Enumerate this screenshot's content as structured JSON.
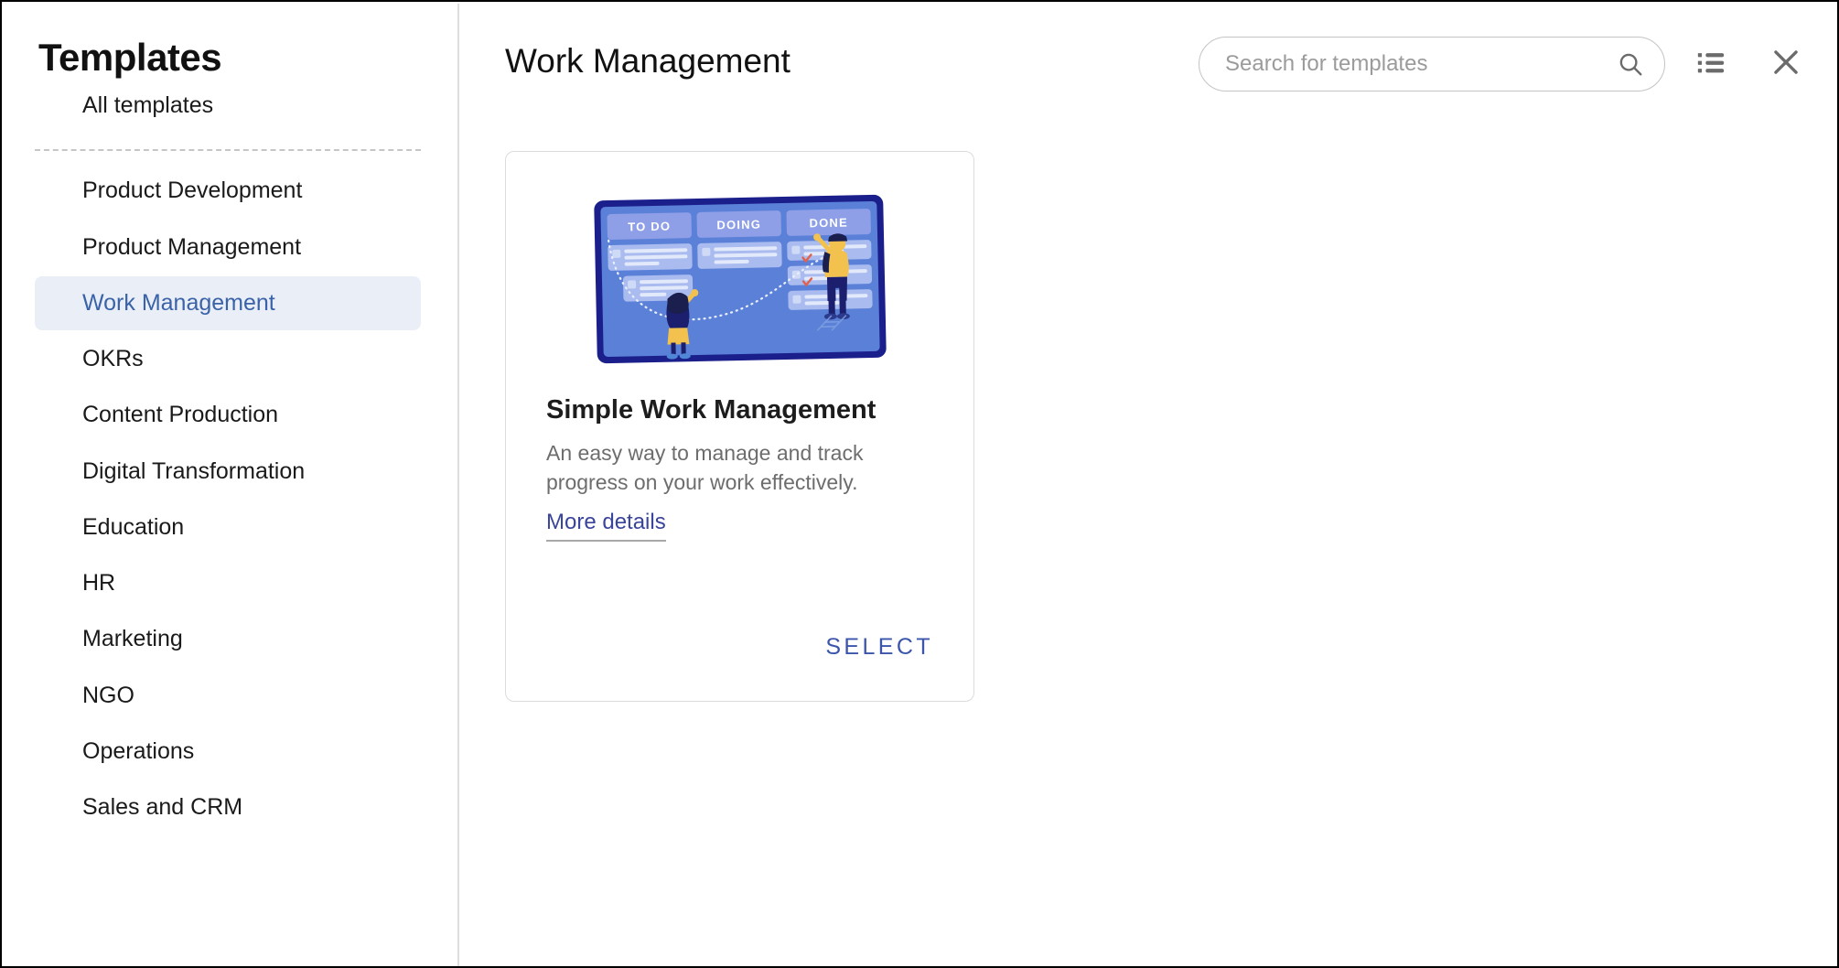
{
  "sidebar": {
    "title": "Templates",
    "all_templates": "All templates",
    "items": [
      {
        "label": "Product Development",
        "selected": false
      },
      {
        "label": "Product Management",
        "selected": false
      },
      {
        "label": "Work Management",
        "selected": true
      },
      {
        "label": "OKRs",
        "selected": false
      },
      {
        "label": "Content Production",
        "selected": false
      },
      {
        "label": "Digital Transformation",
        "selected": false
      },
      {
        "label": "Education",
        "selected": false
      },
      {
        "label": "HR",
        "selected": false
      },
      {
        "label": "Marketing",
        "selected": false
      },
      {
        "label": "NGO",
        "selected": false
      },
      {
        "label": "Operations",
        "selected": false
      },
      {
        "label": "Sales and CRM",
        "selected": false
      }
    ]
  },
  "header": {
    "page_title": "Work Management",
    "search": {
      "placeholder": "Search for templates",
      "value": "",
      "icon": "search-icon"
    },
    "list_view_icon": "list-view-icon",
    "close_icon": "close-icon"
  },
  "cards": [
    {
      "title": "Simple Work Management",
      "description": "An easy way to manage and track progress on your work effectively.",
      "more_details_label": "More details",
      "select_label": "SELECT",
      "thumbnail": {
        "type": "kanban-board-illustration",
        "columns": [
          "TO DO",
          "DOING",
          "DONE"
        ]
      }
    }
  ],
  "colors": {
    "selected_item_bg": "#eaeff7",
    "selected_item_text": "#3a62a8",
    "link_blue": "#39449b",
    "select_blue": "#3b55ab",
    "board_navy": "#1b1f8c",
    "board_blue": "#5b80d8",
    "muted_text": "#6d6d6d",
    "placeholder": "#9b9b9b",
    "card_border": "#dcdcdc"
  }
}
